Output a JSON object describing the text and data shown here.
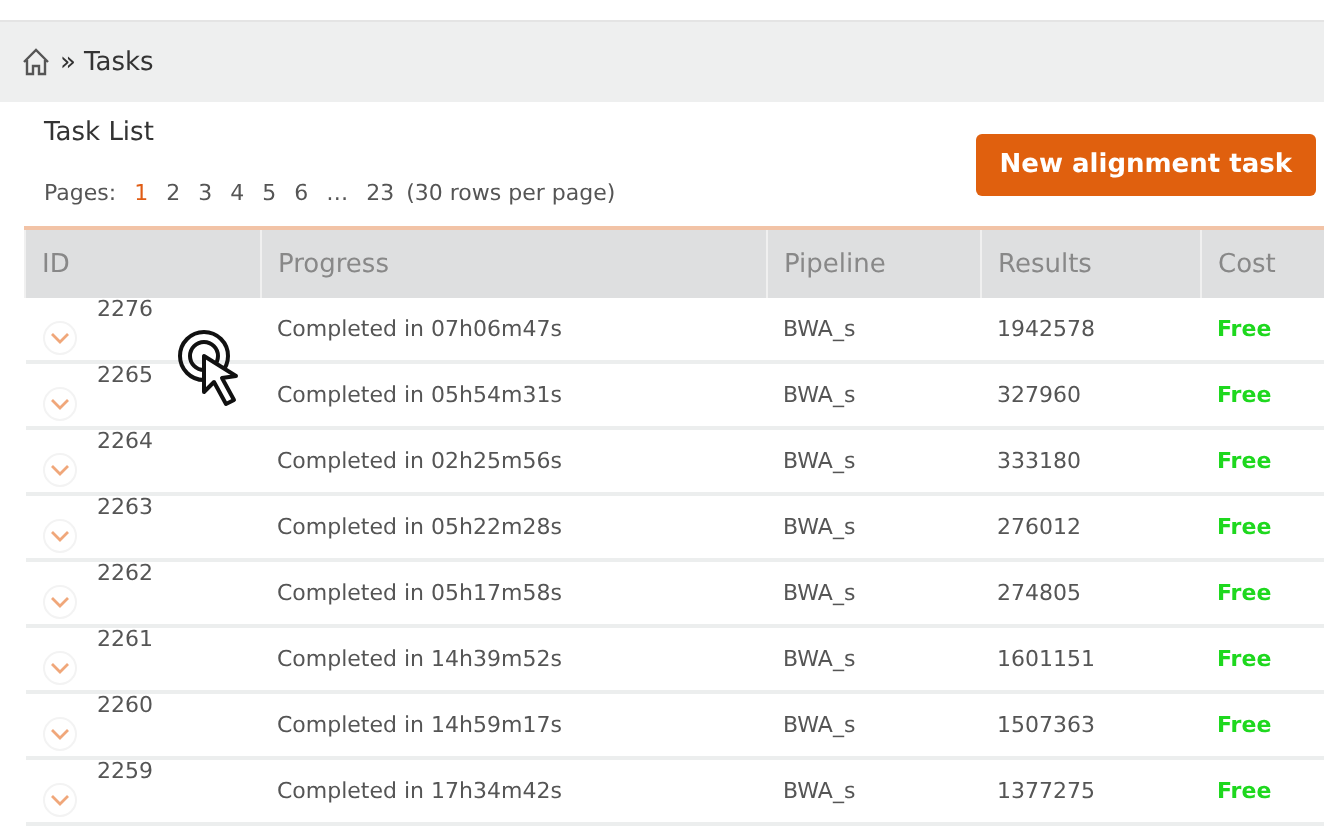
{
  "breadcrumb": {
    "separator": "»",
    "current": "Tasks"
  },
  "panel": {
    "title": "Task List",
    "pages_label": "Pages:",
    "pages": [
      {
        "label": "1",
        "selected": true
      },
      {
        "label": "2",
        "selected": false
      },
      {
        "label": "3",
        "selected": false
      },
      {
        "label": "4",
        "selected": false
      },
      {
        "label": "5",
        "selected": false
      },
      {
        "label": "6",
        "selected": false
      },
      {
        "label": "…",
        "selected": false
      },
      {
        "label": "23",
        "selected": false
      }
    ],
    "rows_per_page": "(30 rows per page)",
    "new_button": "New alignment task"
  },
  "table": {
    "columns": [
      "ID",
      "Progress",
      "Pipeline",
      "Results",
      "Cost"
    ],
    "rows": [
      {
        "id": "2276",
        "progress": "Completed in 07h06m47s",
        "pipeline": "BWA_s",
        "results": "1942578",
        "cost": "Free"
      },
      {
        "id": "2265",
        "progress": "Completed in 05h54m31s",
        "pipeline": "BWA_s",
        "results": "327960",
        "cost": "Free"
      },
      {
        "id": "2264",
        "progress": "Completed in 02h25m56s",
        "pipeline": "BWA_s",
        "results": "333180",
        "cost": "Free"
      },
      {
        "id": "2263",
        "progress": "Completed in 05h22m28s",
        "pipeline": "BWA_s",
        "results": "276012",
        "cost": "Free"
      },
      {
        "id": "2262",
        "progress": "Completed in 05h17m58s",
        "pipeline": "BWA_s",
        "results": "274805",
        "cost": "Free"
      },
      {
        "id": "2261",
        "progress": "Completed in 14h39m52s",
        "pipeline": "BWA_s",
        "results": "1601151",
        "cost": "Free"
      },
      {
        "id": "2260",
        "progress": "Completed in 14h59m17s",
        "pipeline": "BWA_s",
        "results": "1507363",
        "cost": "Free"
      },
      {
        "id": "2259",
        "progress": "Completed in 17h34m42s",
        "pipeline": "BWA_s",
        "results": "1377275",
        "cost": "Free"
      }
    ]
  }
}
